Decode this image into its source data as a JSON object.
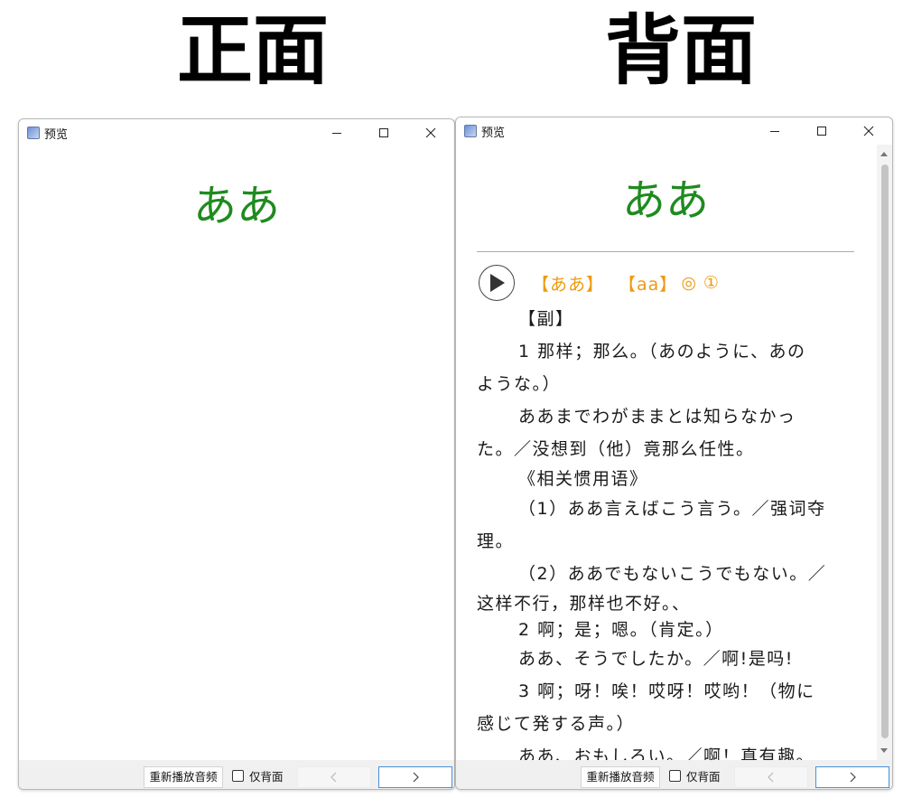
{
  "headings": {
    "front": "正面",
    "back": "背面"
  },
  "window": {
    "title": "预览",
    "minimize_glyph": "—",
    "maximize_glyph": "□",
    "close_glyph": "✕"
  },
  "card": {
    "word": "ああ",
    "reading_kana": "【ああ】",
    "reading_romaji": "【aa】",
    "accent": "◎ ①",
    "definition_lines": [
      "【副】",
      "1 那样；那么。（あのように、あの",
      "ような。）",
      "ああまでわがままとは知らなかっ",
      "た。／没想到（他）竟那么任性。",
      "《相关惯用语》",
      "（1）ああ言えばこう言う。／强词夺",
      "理。",
      "（2）ああでもないこうでもない。／",
      "这样不行，那样也不好。、",
      "2 啊；是；嗯。（肯定。）",
      "ああ、そうでしたか。／啊!是吗!",
      "3 啊；呀！唉！哎呀！哎哟！（物に",
      "感じて発する声。）",
      "ああ、おもしろい。／啊！真有趣。"
    ]
  },
  "statusbar": {
    "replay_audio": "重新播放音频",
    "back_only_label": "仅背面",
    "back_only_checked": false,
    "prev_glyph": "‹",
    "next_glyph": "›"
  },
  "colors": {
    "word": "#1f8b1f",
    "reading": "#ee9a10",
    "next_border": "#4a8fd8"
  },
  "icons": [
    "app-icon",
    "minimize-icon",
    "maximize-icon",
    "close-icon",
    "play-icon",
    "chevron-left-icon",
    "chevron-right-icon"
  ]
}
